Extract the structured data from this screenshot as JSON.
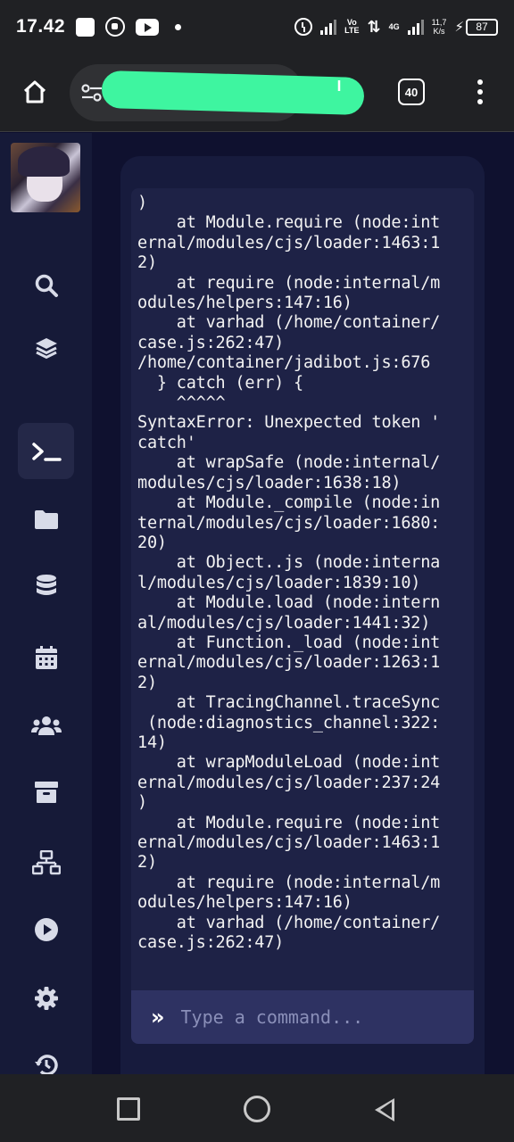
{
  "status_bar": {
    "time": "17.42",
    "volte_top": "Vo",
    "volte_bottom": "LTE",
    "network": "4G",
    "speed_value": "11,7",
    "speed_unit": "K/s",
    "battery": "87"
  },
  "browser": {
    "url": "",
    "tab_count": "40"
  },
  "terminal": {
    "output_lines": [
      ")",
      "    at Module.require (node:int",
      "ernal/modules/cjs/loader:1463:1",
      "2)",
      "    at require (node:internal/m",
      "odules/helpers:147:16)",
      "    at varhad (/home/container/",
      "case.js:262:47)",
      "/home/container/jadibot.js:676",
      "  } catch (err) {",
      "    ^^^^^",
      "SyntaxError: Unexpected token '",
      "catch'",
      "    at wrapSafe (node:internal/",
      "modules/cjs/loader:1638:18)",
      "    at Module._compile (node:in",
      "ternal/modules/cjs/loader:1680:",
      "20)",
      "    at Object..js (node:interna",
      "l/modules/cjs/loader:1839:10)",
      "    at Module.load (node:intern",
      "al/modules/cjs/loader:1441:32)",
      "    at Function._load (node:int",
      "ernal/modules/cjs/loader:1263:1",
      "2)",
      "    at TracingChannel.traceSync",
      " (node:diagnostics_channel:322:",
      "14)",
      "    at wrapModuleLoad (node:int",
      "ernal/modules/cjs/loader:237:24",
      ")",
      "    at Module.require (node:int",
      "ernal/modules/cjs/loader:1463:1",
      "2)",
      "    at require (node:internal/m",
      "odules/helpers:147:16)",
      "    at varhad (/home/container/",
      "case.js:262:47)"
    ],
    "prompt_symbol": "»",
    "command_placeholder": "Type a command..."
  },
  "sidebar": {
    "items": [
      {
        "icon": "search-icon"
      },
      {
        "icon": "layers-icon"
      },
      {
        "icon": "terminal-icon",
        "active": true
      },
      {
        "icon": "folder-icon"
      },
      {
        "icon": "database-icon"
      },
      {
        "icon": "calendar-icon"
      },
      {
        "icon": "users-icon"
      },
      {
        "icon": "archive-icon"
      },
      {
        "icon": "network-icon"
      },
      {
        "icon": "play-icon"
      },
      {
        "icon": "settings-icon"
      },
      {
        "icon": "history-icon"
      }
    ]
  },
  "colors": {
    "page_bg": "#0f112f",
    "sidebar_bg": "#161a38",
    "card_bg": "#171b3d",
    "terminal_bg": "#1e2246",
    "command_bar_bg": "#2e3262",
    "redaction": "#3ef5a0"
  }
}
